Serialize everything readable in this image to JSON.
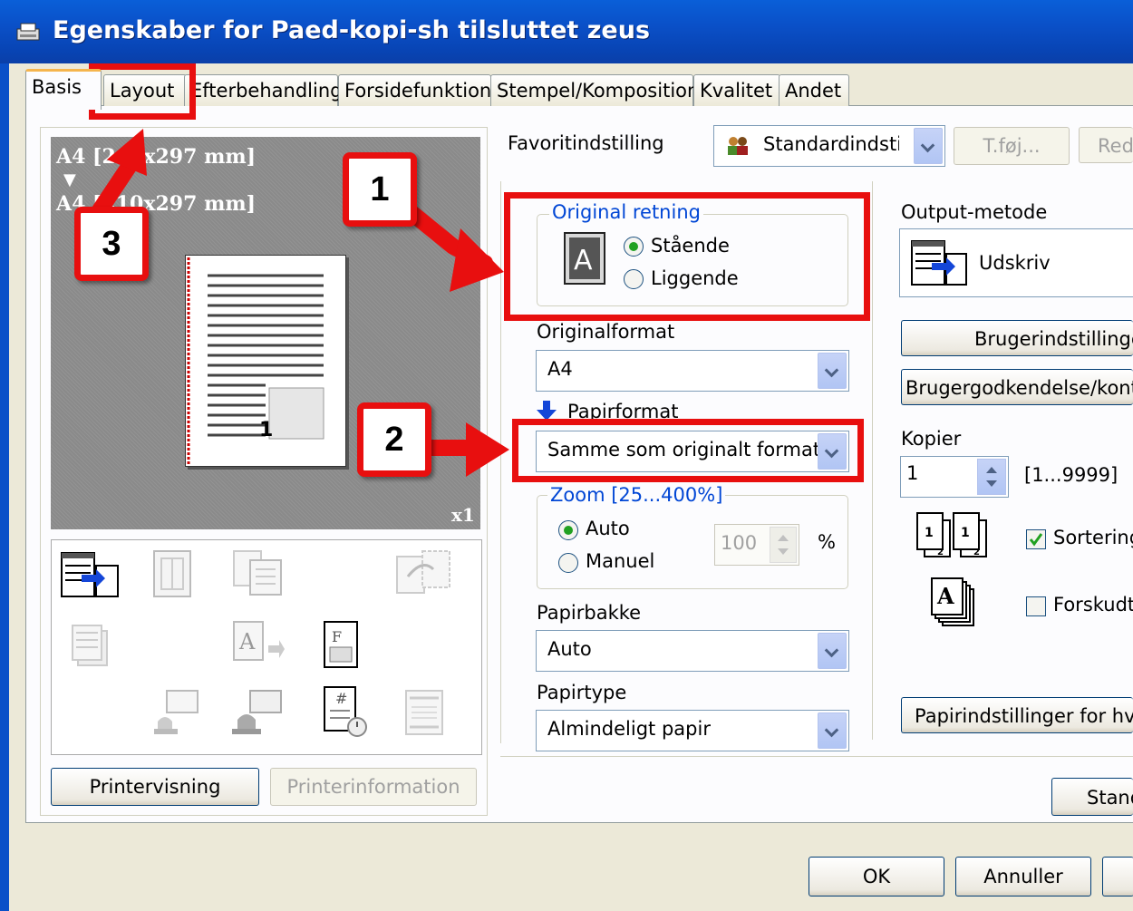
{
  "window": {
    "title": "Egenskaber for Paed-kopi-sh tilsluttet zeus"
  },
  "tabs": [
    {
      "label": "Basis"
    },
    {
      "label": "Layout"
    },
    {
      "label": "Efterbehandling"
    },
    {
      "label": "Forsidefunktion"
    },
    {
      "label": "Stempel/Komposition"
    },
    {
      "label": "Kvalitet"
    },
    {
      "label": "Andet"
    }
  ],
  "favorites": {
    "label": "Favoritindstilling",
    "value": "Standardindstilling",
    "add_button": "T.føj...",
    "edit_button": "Red"
  },
  "preview": {
    "line1": "A4 [210x297 mm]",
    "line2": "A4 [210x297 mm]",
    "copies": "x1",
    "page_number": "1"
  },
  "orientation": {
    "legend": "Original retning",
    "portrait": "Stående",
    "landscape": "Liggende",
    "selected": "portrait",
    "icon_letter": "A"
  },
  "original_format": {
    "label": "Originalformat",
    "value": "A4"
  },
  "paper_format": {
    "label": "Papirformat",
    "value": "Samme som originalt format"
  },
  "zoom": {
    "legend": "Zoom  [25...400%]",
    "auto": "Auto",
    "manual": "Manuel",
    "selected": "auto",
    "value": "100",
    "unit": "%"
  },
  "paper_tray": {
    "label": "Papirbakke",
    "value": "Auto"
  },
  "paper_type": {
    "label": "Papirtype",
    "value": "Almindeligt papir"
  },
  "output": {
    "label": "Output-metode",
    "value": "Udskriv"
  },
  "user_settings_button": "Brugerindstillinger...",
  "user_auth_button": "Brugergodkendelse/kontosporing...",
  "copies": {
    "label": "Kopier",
    "value": "1",
    "range": "[1...9999]"
  },
  "collate": {
    "label": "Sortering",
    "checked": true
  },
  "offset": {
    "label": "Forskudt",
    "checked": false
  },
  "paper_settings_button": "Papirindstillinger for hver bakke...",
  "preview_button": "Printervisning",
  "printer_info_button": "Printerinformation",
  "standard_button": "Standard",
  "dialog": {
    "ok": "OK",
    "cancel": "Annuller"
  },
  "annotations": {
    "callout1": "1",
    "callout2": "2",
    "callout3": "3",
    "highlight_color": "#e80f0f"
  }
}
